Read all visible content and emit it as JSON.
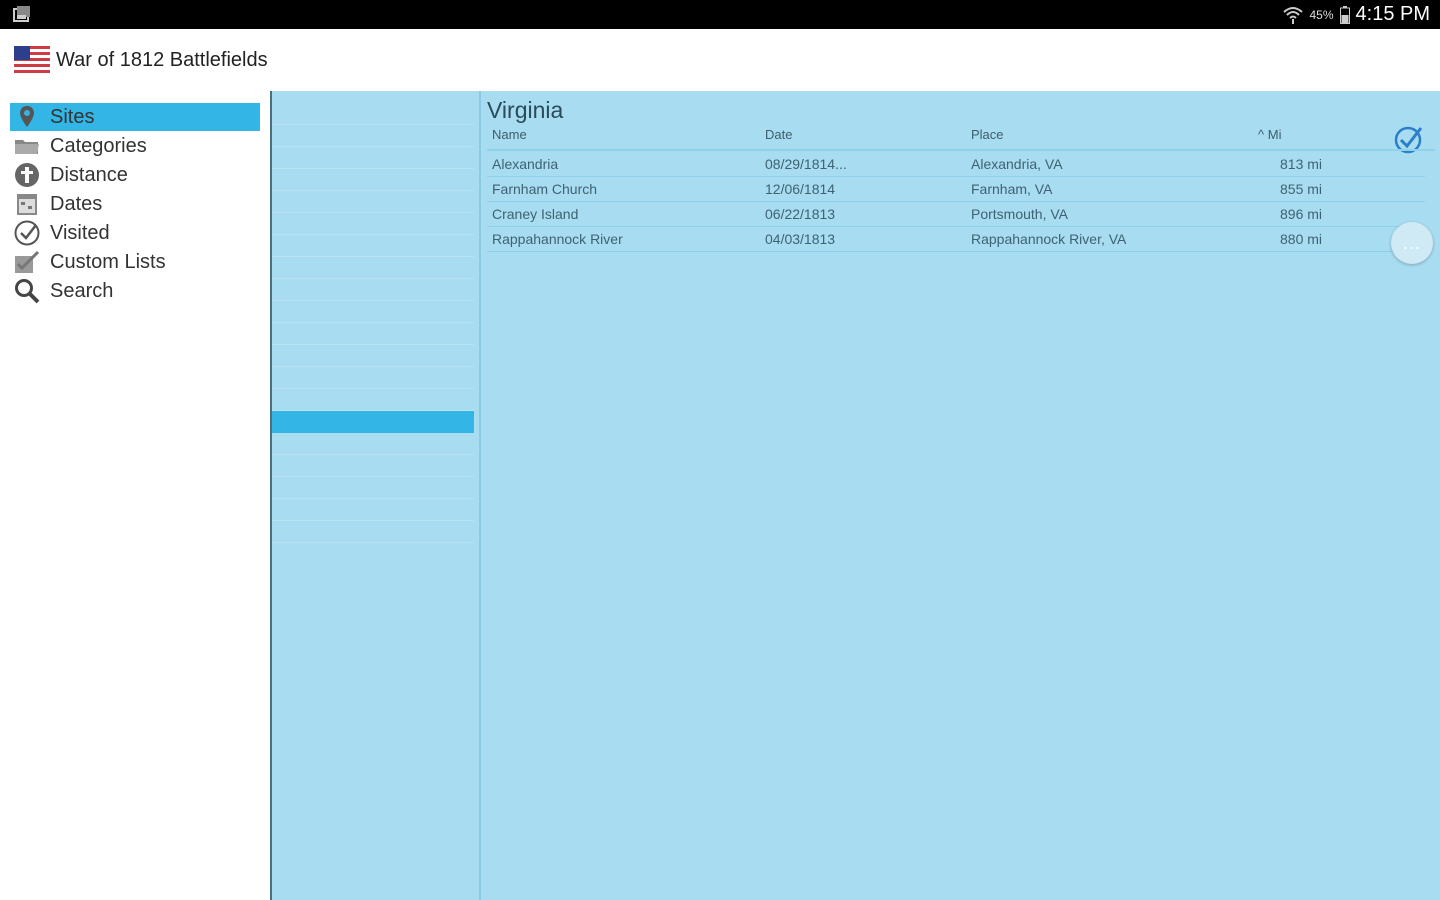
{
  "statusbar": {
    "notification_icon": "gallery-icon",
    "battery_percent": "45%",
    "time": "4:15 PM"
  },
  "appbar": {
    "title": "War of 1812 Battlefields",
    "logo_icon": "us-flag-icon"
  },
  "nav": {
    "items": [
      {
        "label": "Sites",
        "icon": "map-pin-icon",
        "active": true
      },
      {
        "label": "Categories",
        "icon": "folder-icon",
        "active": false
      },
      {
        "label": "Distance",
        "icon": "distance-icon",
        "active": false
      },
      {
        "label": "Dates",
        "icon": "calendar-icon",
        "active": false
      },
      {
        "label": "Visited",
        "icon": "check-circle-icon",
        "active": false
      },
      {
        "label": "Custom Lists",
        "icon": "custom-list-icon",
        "active": false
      },
      {
        "label": "Search",
        "icon": "search-icon",
        "active": false
      }
    ]
  },
  "midlist": {
    "selected_index": 14
  },
  "detail": {
    "state_title": "Virginia",
    "columns": {
      "name": "Name",
      "date": "Date",
      "place": "Place",
      "mi": "Mi"
    },
    "sort_indicator": "^",
    "rows": [
      {
        "name": "Alexandria",
        "date": "08/29/1814...",
        "place": "Alexandria, VA",
        "mi": "813 mi"
      },
      {
        "name": "Farnham Church",
        "date": "12/06/1814",
        "place": "Farnham, VA",
        "mi": "855 mi"
      },
      {
        "name": "Craney Island",
        "date": "06/22/1813",
        "place": "Portsmouth, VA",
        "mi": "896 mi"
      },
      {
        "name": "Rappahannock River",
        "date": "04/03/1813",
        "place": "Rappahannock River, VA",
        "mi": "880 mi"
      }
    ],
    "more_label": "..."
  },
  "colors": {
    "accent": "#33b5e5",
    "panel": "#a8dcf0",
    "text_dark": "#333333"
  }
}
